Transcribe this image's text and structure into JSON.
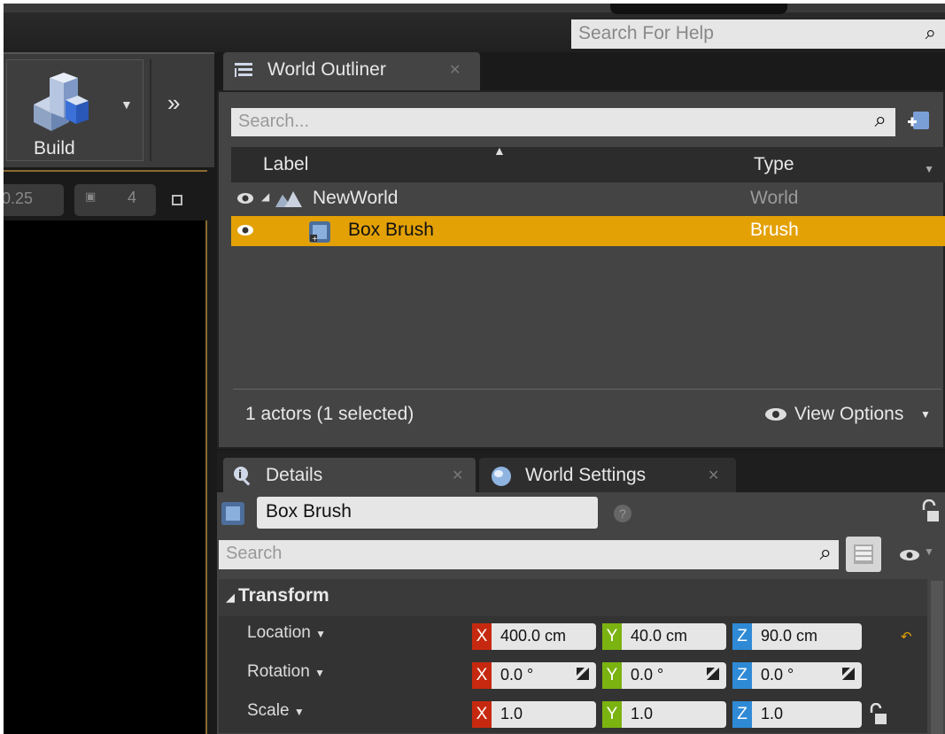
{
  "top": {
    "help_placeholder": "Search For Help"
  },
  "toolbar": {
    "build_label": "Build"
  },
  "viewport": {
    "snap_value": "0.25",
    "camera_speed": "4"
  },
  "outliner": {
    "tab_label": "World Outliner",
    "search_placeholder": "Search...",
    "columns": [
      "Label",
      "Type"
    ],
    "rows": [
      {
        "label": "NewWorld",
        "type": "World"
      },
      {
        "label": "Box Brush",
        "type": "Brush"
      }
    ],
    "status": "1 actors (1 selected)",
    "view_options": "View Options"
  },
  "details": {
    "tabs": [
      "Details",
      "World Settings"
    ],
    "actor_name": "Box Brush",
    "search_placeholder": "Search",
    "section": "Transform",
    "properties": [
      {
        "label": "Location",
        "x": "400.0 cm",
        "y": "40.0 cm",
        "z": "90.0 cm"
      },
      {
        "label": "Rotation",
        "x": "0.0 °",
        "y": "0.0 °",
        "z": "0.0 °"
      },
      {
        "label": "Scale",
        "x": "1.0",
        "y": "1.0",
        "z": "1.0"
      }
    ],
    "axes": [
      "X",
      "Y",
      "Z"
    ]
  },
  "colors": {
    "selection": "#e3a106",
    "axis_x": "#c6290f",
    "axis_y": "#7bb311",
    "axis_z": "#2f8ad6"
  }
}
